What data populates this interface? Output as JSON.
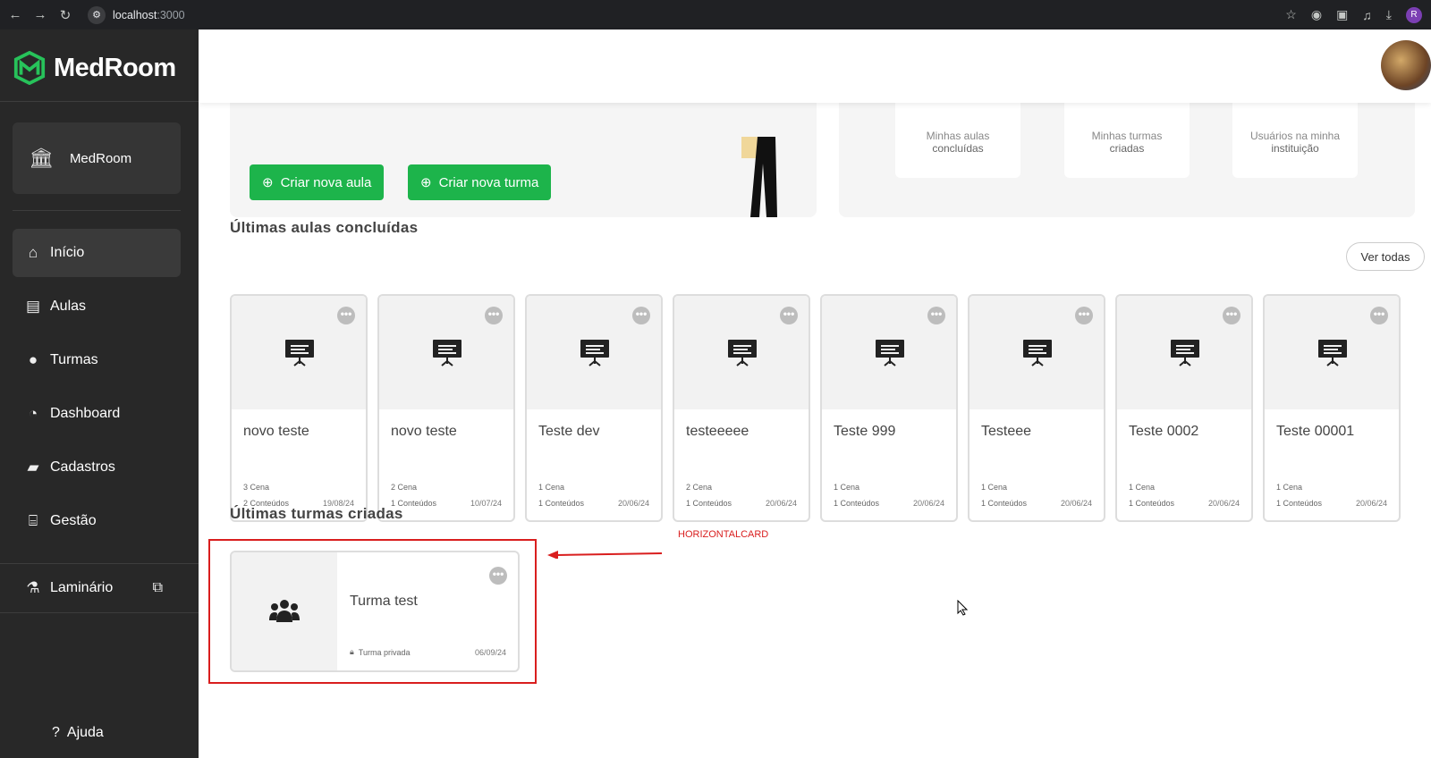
{
  "browser": {
    "url_host": "localhost",
    "url_port": ":3000",
    "profile_initial": "R"
  },
  "sidebar": {
    "brand": "MedRoom",
    "institution": "MedRoom",
    "items": [
      {
        "label": "Início",
        "icon": "home-icon"
      },
      {
        "label": "Aulas",
        "icon": "presentation-icon"
      },
      {
        "label": "Turmas",
        "icon": "users-icon"
      },
      {
        "label": "Dashboard",
        "icon": "pie-chart-icon"
      },
      {
        "label": "Cadastros",
        "icon": "briefcase-icon"
      },
      {
        "label": "Gestão",
        "icon": "institution-icon"
      }
    ],
    "laminario": "Laminário",
    "help": "Ajuda"
  },
  "hero": {
    "btn_aula": "Criar nova aula",
    "btn_turma": "Criar nova turma"
  },
  "stats": [
    {
      "top": "Minhas aulas",
      "label": "concluídas"
    },
    {
      "top": "Minhas turmas",
      "label": "criadas"
    },
    {
      "top": "Usuários na minha",
      "label": "instituição"
    }
  ],
  "aulas": {
    "heading": "Últimas aulas concluídas",
    "ver_todas": "Ver todas",
    "cards": [
      {
        "title": "novo teste",
        "cenas": "3 Cena",
        "conteudos": "2 Conteúdos",
        "date": "19/08/24"
      },
      {
        "title": "novo teste",
        "cenas": "2 Cena",
        "conteudos": "1 Conteúdos",
        "date": "10/07/24"
      },
      {
        "title": "Teste dev",
        "cenas": "1 Cena",
        "conteudos": "1 Conteúdos",
        "date": "20/06/24"
      },
      {
        "title": "testeeeee",
        "cenas": "2 Cena",
        "conteudos": "1 Conteúdos",
        "date": "20/06/24"
      },
      {
        "title": "Teste 999",
        "cenas": "1 Cena",
        "conteudos": "1 Conteúdos",
        "date": "20/06/24"
      },
      {
        "title": "Testeee",
        "cenas": "1 Cena",
        "conteudos": "1 Conteúdos",
        "date": "20/06/24"
      },
      {
        "title": "Teste 0002",
        "cenas": "1 Cena",
        "conteudos": "1 Conteúdos",
        "date": "20/06/24"
      },
      {
        "title": "Teste 00001",
        "cenas": "1 Cena",
        "conteudos": "1 Conteúdos",
        "date": "20/06/24"
      }
    ]
  },
  "turmas": {
    "heading": "Últimas turmas criadas",
    "card": {
      "title": "Turma test",
      "privacy": "Turma privada",
      "date": "06/09/24"
    }
  },
  "annotation": {
    "label": "HORIZONTALCARD",
    "color": "#d91e1e"
  },
  "colors": {
    "sidebar": "#282828",
    "accent_green": "#1db44b"
  }
}
